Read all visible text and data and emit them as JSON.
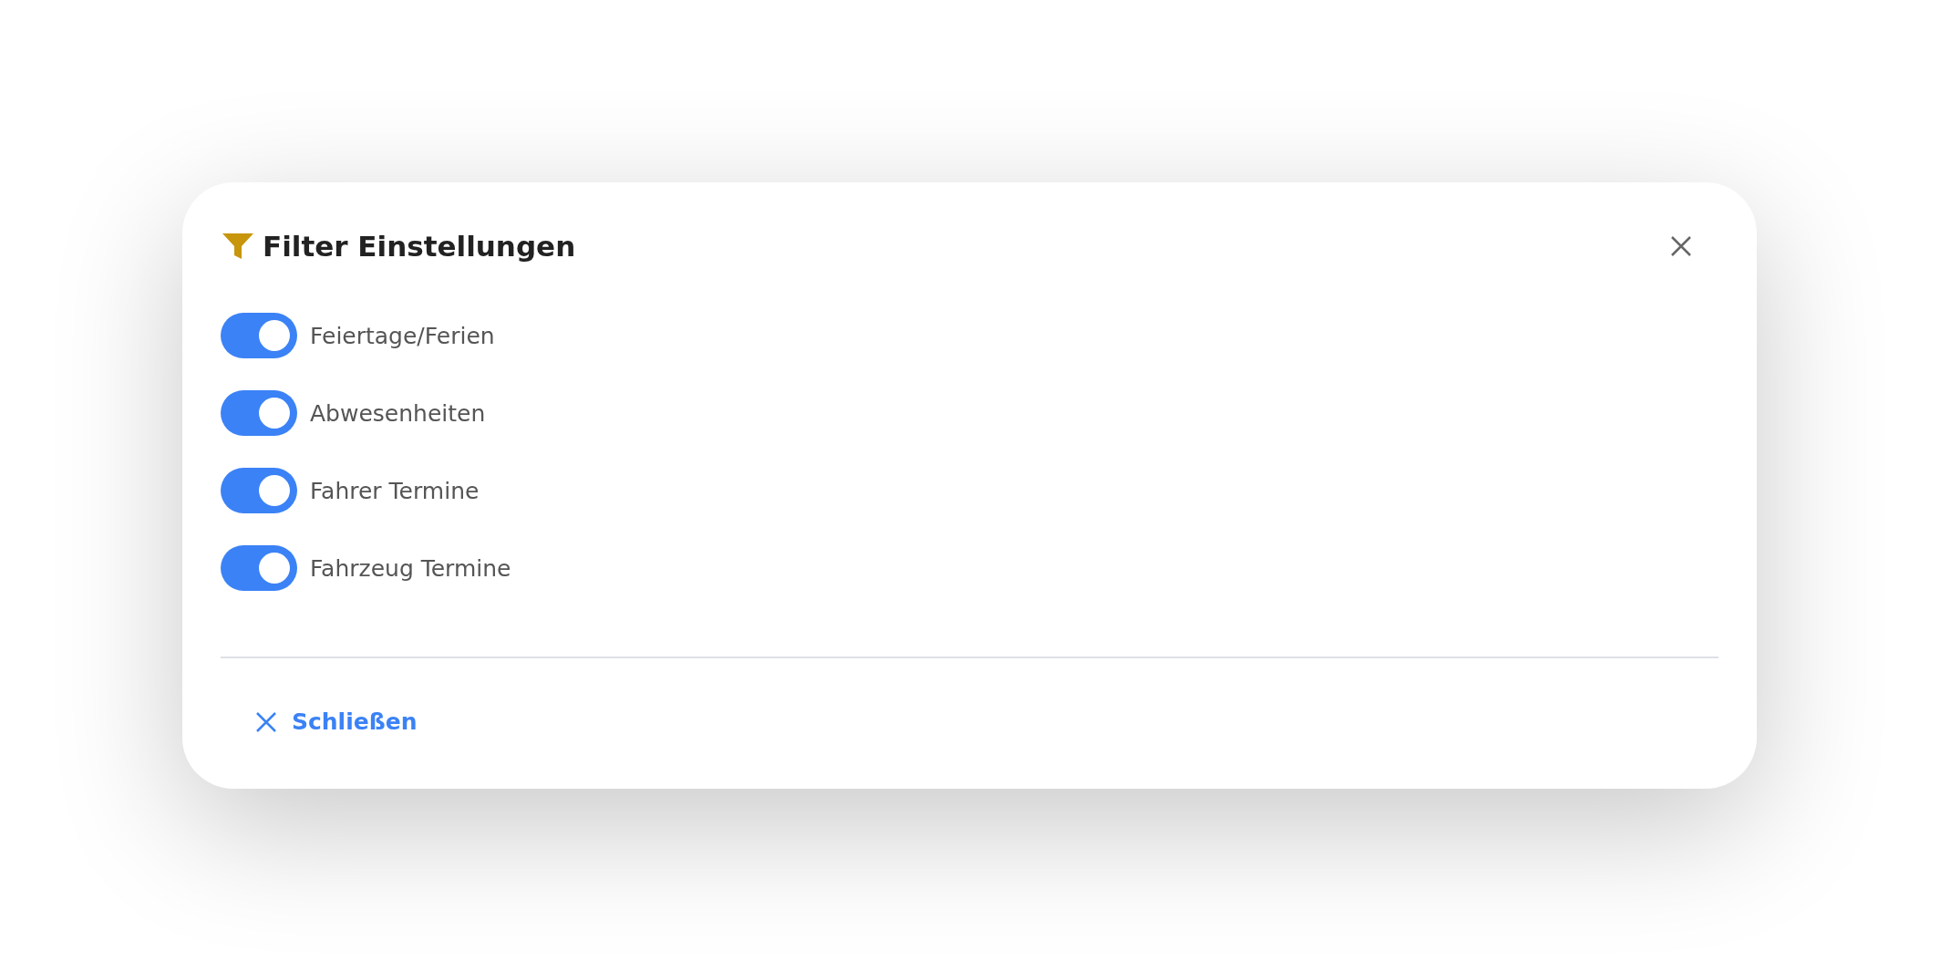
{
  "dialog": {
    "title": "Filter Einstellungen",
    "toggles": [
      {
        "label": "Feiertage/Ferien",
        "on": true
      },
      {
        "label": "Abwesenheiten",
        "on": true
      },
      {
        "label": "Fahrer Termine",
        "on": true
      },
      {
        "label": "Fahrzeug Termine",
        "on": true
      }
    ],
    "close_button": {
      "label": "Schließen"
    }
  }
}
